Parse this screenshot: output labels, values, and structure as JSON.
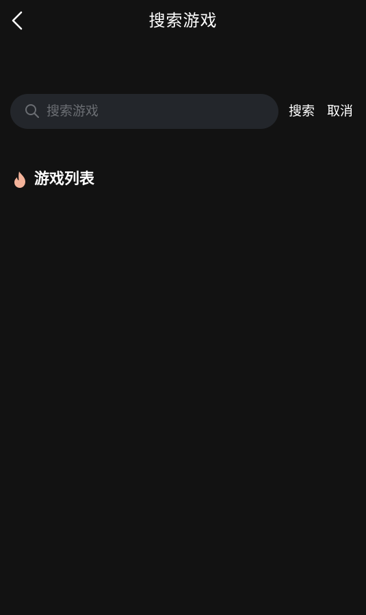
{
  "header": {
    "title": "搜索游戏",
    "back_icon": "chevron-left-icon"
  },
  "search": {
    "placeholder": "搜索游戏",
    "value": "",
    "icon": "search-icon",
    "search_label": "搜索",
    "cancel_label": "取消"
  },
  "section": {
    "icon": "flame-icon",
    "title": "游戏列表",
    "items": []
  },
  "colors": {
    "background": "#121212",
    "search_box": "#23262b",
    "placeholder": "#6b6e73",
    "flame": "#f4b39a",
    "text": "#ffffff"
  }
}
